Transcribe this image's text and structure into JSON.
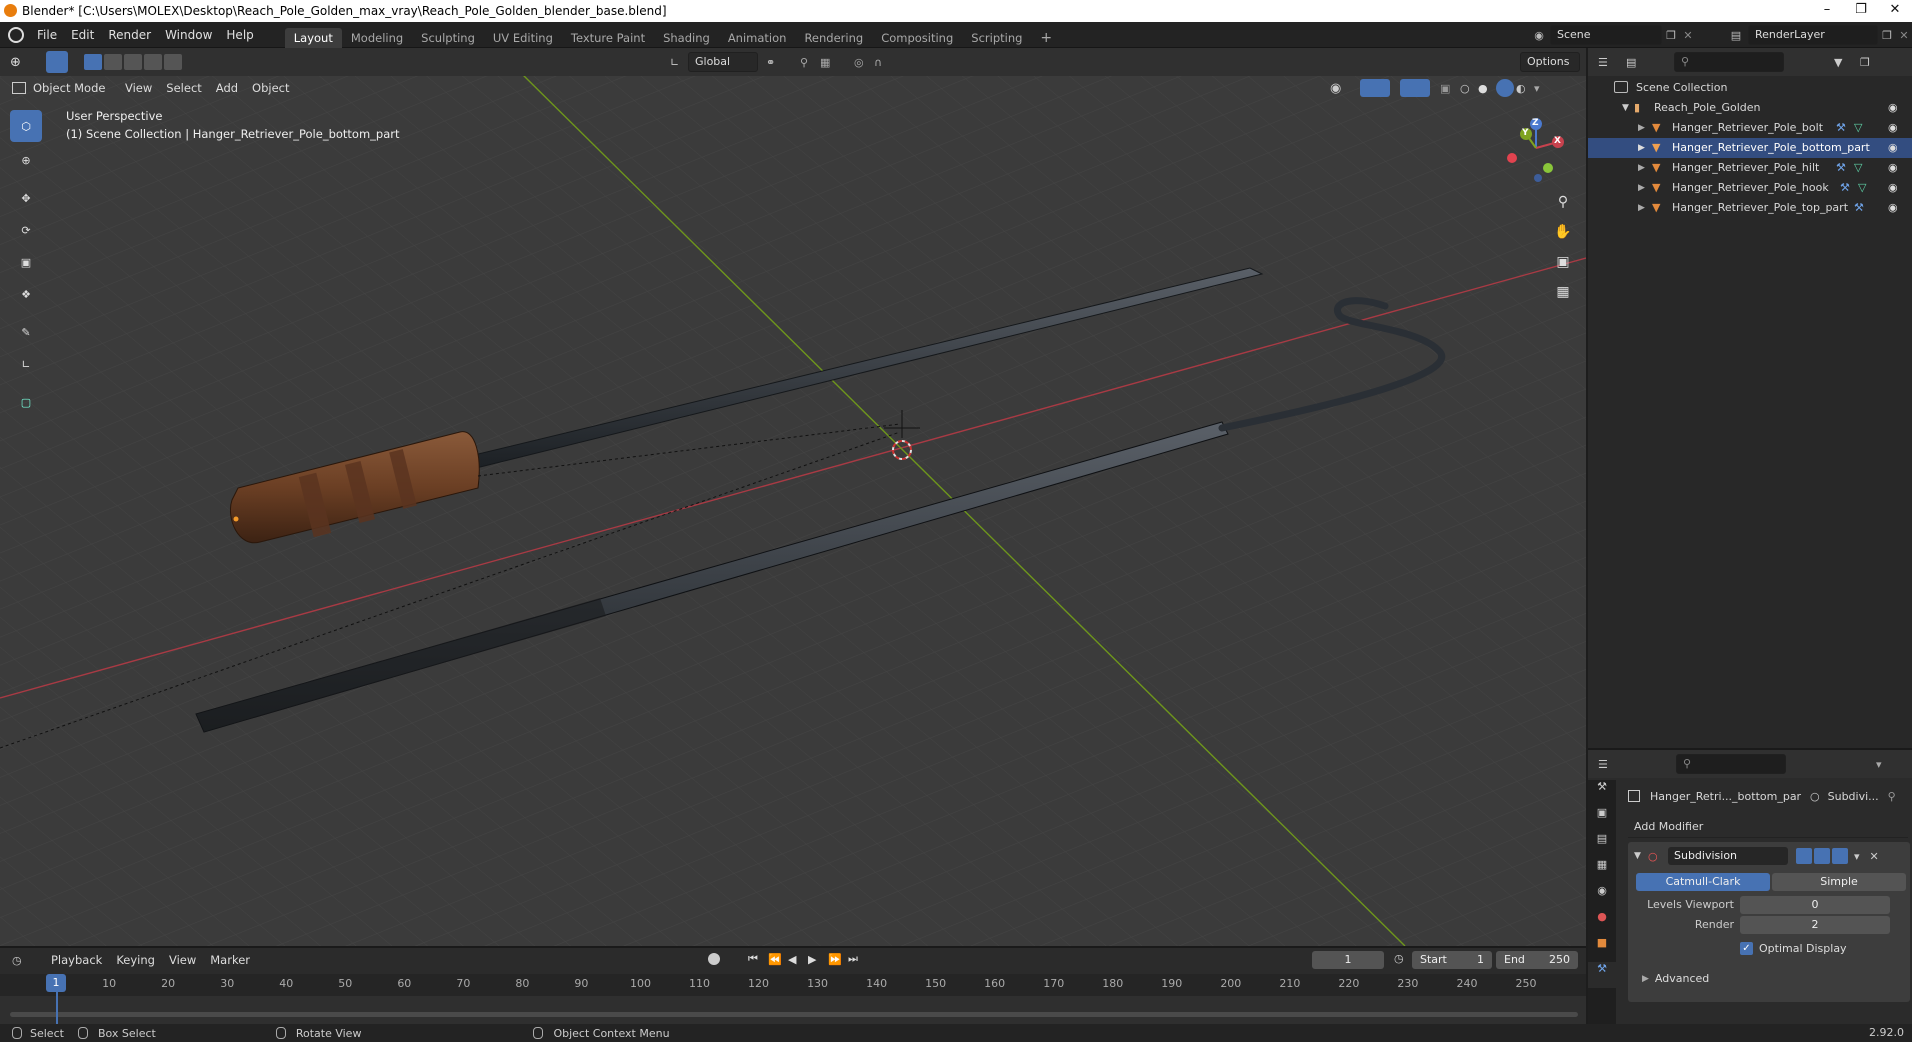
{
  "window": {
    "title": "Blender* [C:\\Users\\MOLEX\\Desktop\\Reach_Pole_Golden_max_vray\\Reach_Pole_Golden_blender_base.blend]"
  },
  "menu": {
    "file": "File",
    "edit": "Edit",
    "render": "Render",
    "window": "Window",
    "help": "Help"
  },
  "workspaces": [
    "Layout",
    "Modeling",
    "Sculpting",
    "UV Editing",
    "Texture Paint",
    "Shading",
    "Animation",
    "Rendering",
    "Compositing",
    "Scripting"
  ],
  "scene": {
    "name": "Scene",
    "render_layer": "RenderLayer"
  },
  "viewport_header": {
    "transform_orientation": "Global",
    "options": "Options",
    "mode": "Object Mode",
    "view": "View",
    "select": "Select",
    "add": "Add",
    "object": "Object"
  },
  "viewport": {
    "perspective_label": "User Perspective",
    "collection_label": "(1) Scene Collection | Hanger_Retriever_Pole_bottom_part"
  },
  "gizmo": {
    "z": "Z",
    "x": "X",
    "y": "Y"
  },
  "outliner": {
    "root": "Scene Collection",
    "collection": "Reach_Pole_Golden",
    "objects": [
      "Hanger_Retriever_Pole_bolt",
      "Hanger_Retriever_Pole_bottom_part",
      "Hanger_Retriever_Pole_hilt",
      "Hanger_Retriever_Pole_hook",
      "Hanger_Retriever_Pole_top_part"
    ]
  },
  "properties": {
    "object_name": "Hanger_Retri..._bottom_par",
    "modifier_short": "Subdivi...",
    "add_modifier": "Add Modifier",
    "modifier_name": "Subdivision",
    "catmull": "Catmull-Clark",
    "simple": "Simple",
    "levels_viewport_label": "Levels Viewport",
    "levels_viewport_value": "0",
    "render_label": "Render",
    "render_value": "2",
    "optimal_display": "Optimal Display",
    "advanced": "Advanced"
  },
  "timeline": {
    "playback": "Playback",
    "keying": "Keying",
    "view": "View",
    "marker": "Marker",
    "current_frame": "1",
    "start_label": "Start",
    "start_value": "1",
    "end_label": "End",
    "end_value": "250",
    "ticks": [
      "1",
      "10",
      "20",
      "30",
      "40",
      "50",
      "60",
      "70",
      "80",
      "90",
      "100",
      "110",
      "120",
      "130",
      "140",
      "150",
      "160",
      "170",
      "180",
      "190",
      "200",
      "210",
      "220",
      "230",
      "240",
      "250"
    ]
  },
  "status": {
    "select": "Select",
    "box_select": "Box Select",
    "rotate_view": "Rotate View",
    "context_menu": "Object Context Menu",
    "version": "2.92.0"
  },
  "colors": {
    "accent": "#4772b3",
    "x_axis": "#c0424c",
    "y_axis": "#7fa320",
    "object_orange": "#e38a3c"
  }
}
